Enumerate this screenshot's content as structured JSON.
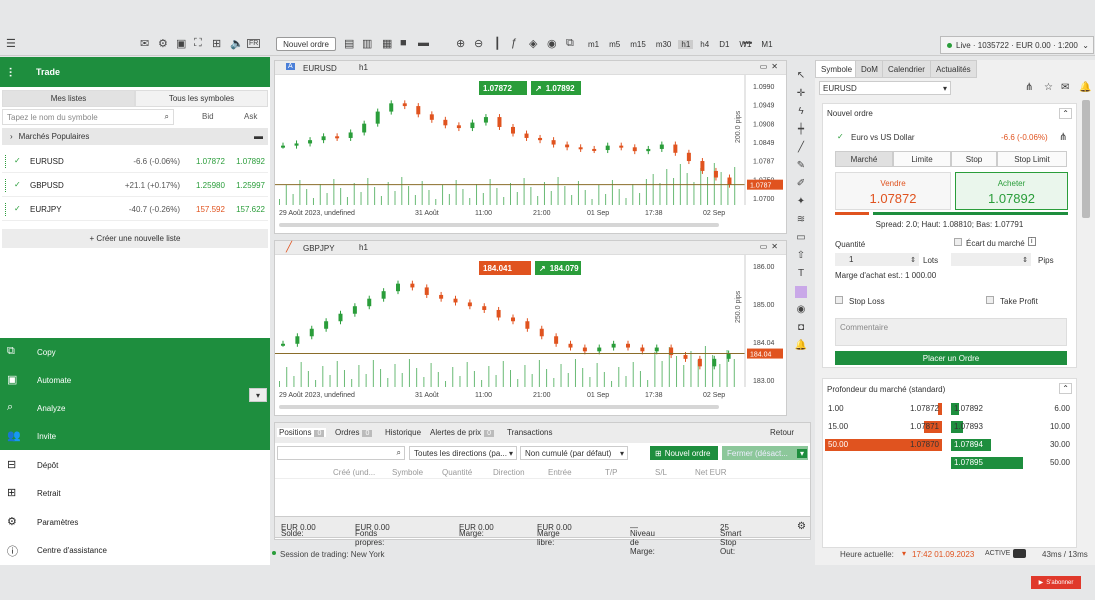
{
  "toolbar": {
    "new_order": "Nouvel ordre",
    "timeframes": [
      "m1",
      "m5",
      "m15",
      "m30",
      "h1",
      "h4",
      "D1",
      "W1",
      "M1"
    ],
    "more": "•••",
    "live": "Live · 1035722 · EUR 0.00 · 1:200"
  },
  "left": {
    "title": "Trade",
    "tabs": [
      "Mes listes",
      "Tous les symboles"
    ],
    "search_placeholder": "Tapez le nom du symbole",
    "bid_header": "Bid",
    "ask_header": "Ask",
    "group": "Marchés Populaires",
    "symbols": [
      {
        "name": "EURUSD",
        "change": "-6.6 (-0.06%)",
        "bid": "1.07872",
        "ask": "1.07892"
      },
      {
        "name": "GBPUSD",
        "change": "+21.1 (+0.17%)",
        "bid": "1.25980",
        "ask": "1.25997"
      },
      {
        "name": "EURJPY",
        "change": "-40.7 (-0.26%)",
        "bid": "157.592",
        "ask": "157.622"
      }
    ],
    "create_list": "+ Créer une nouvelle liste",
    "nav": [
      "Copy",
      "Automate",
      "Analyze",
      "Invite",
      "Dépôt",
      "Retrait",
      "Paramètres",
      "Centre d'assistance"
    ],
    "collapse": "▾"
  },
  "charts": [
    {
      "symbol": "EURUSD",
      "timeframe": "h1",
      "sell": "1.07872",
      "buy": "1.07892",
      "price_labels": [
        "1.0990",
        "1.0949",
        "1.0908",
        "1.0849",
        "1.0787",
        "1.0750",
        "1.0700"
      ],
      "current": "1.0787",
      "pips": "200.0 pips",
      "time_labels": [
        "29 Août 2023, undefined",
        "31 Août",
        "11:00",
        "21:00",
        "01 Sep",
        "17:38",
        "02 Sep"
      ],
      "series": [
        1.0858,
        1.0862,
        1.0868,
        1.0875,
        1.0872,
        1.0882,
        1.0898,
        1.092,
        1.0935,
        1.093,
        1.0915,
        1.0905,
        1.0895,
        1.089,
        1.09,
        1.091,
        1.0892,
        1.088,
        1.0872,
        1.0868,
        1.086,
        1.0855,
        1.0852,
        1.085,
        1.0858,
        1.0855,
        1.0848,
        1.0852,
        1.086,
        1.0845,
        1.083,
        1.0812,
        1.08,
        1.0787
      ]
    },
    {
      "symbol": "GBPJPY",
      "timeframe": "h1",
      "sell": "184.041",
      "buy": "184.079",
      "price_labels": [
        "186.00",
        "185.00",
        "184.04",
        "183.00"
      ],
      "current": "184.04",
      "pips": "250.0 pips",
      "time_labels": [
        "29 Août 2023, undefined",
        "31 Août",
        "11:00",
        "21:00",
        "01 Sep",
        "17:38",
        "02 Sep"
      ],
      "series": [
        184.3,
        184.5,
        184.7,
        184.9,
        185.1,
        185.3,
        185.5,
        185.7,
        185.9,
        185.8,
        185.6,
        185.5,
        185.4,
        185.3,
        185.2,
        185.0,
        184.9,
        184.7,
        184.5,
        184.3,
        184.2,
        184.1,
        184.2,
        184.3,
        184.2,
        184.1,
        184.2,
        184.0,
        183.9,
        183.7,
        183.9,
        184.04
      ]
    }
  ],
  "positions": {
    "tabs": [
      {
        "label": "Positions",
        "count": "0"
      },
      {
        "label": "Ordres",
        "count": "0"
      },
      {
        "label": "Historique",
        "count": ""
      },
      {
        "label": "Alertes de prix",
        "count": "0"
      },
      {
        "label": "Transactions",
        "count": ""
      }
    ],
    "retour": "Retour",
    "filter_direction": "Toutes les directions (pa...",
    "filter_cumul": "Non cumulé (par défaut)",
    "new_order": "Nouvel ordre",
    "close": "Fermer (désact...",
    "columns": [
      "Créé (und...",
      "Symbole",
      "Quantité",
      "Direction",
      "Entrée",
      "T/P",
      "S/L",
      "Net EUR"
    ],
    "account": [
      {
        "label": "Solde:",
        "value": "EUR 0.00"
      },
      {
        "label": "Fonds propres:",
        "value": "EUR 0.00"
      },
      {
        "label": "Marge:",
        "value": "EUR 0.00"
      },
      {
        "label": "Marge libre:",
        "value": "EUR 0.00"
      },
      {
        "label": "Niveau de Marge:",
        "value": "—"
      },
      {
        "label": "Smart Stop Out:",
        "value": "25"
      }
    ]
  },
  "right": {
    "tabs": [
      "Symbole",
      "DoM",
      "Calendrier",
      "Actualités"
    ],
    "symbol": "EURUSD",
    "order_title": "Nouvel ordre",
    "instrument": "Euro vs US Dollar",
    "instrument_change": "-6.6 (-0.06%)",
    "order_types": [
      "Marché",
      "Limite",
      "Stop",
      "Stop Limit"
    ],
    "sell_label": "Vendre",
    "sell_price": "1.07872",
    "buy_label": "Acheter",
    "buy_price": "1.07892",
    "spread": "Spread: 2.0; Haut: 1.08810; Bas: 1.07791",
    "quantity_label": "Quantité",
    "deviation_label": "Écart du marché",
    "quantity_value": "1",
    "lots": "Lots",
    "pips": "Pips",
    "margin": "Marge d'achat est.: 1 000.00",
    "stop_loss": "Stop Loss",
    "take_profit": "Take Profit",
    "comment_placeholder": "Commentaire",
    "place_order": "Placer un Ordre",
    "depth_title": "Profondeur du marché (standard)",
    "depth_bids": [
      {
        "vol": "1.00",
        "price": "1.07872"
      },
      {
        "vol": "15.00",
        "price": "1.07871"
      },
      {
        "vol": "50.00",
        "price": "1.07870"
      }
    ],
    "depth_asks": [
      {
        "price": "1.07892",
        "vol": "6.00"
      },
      {
        "price": "1.07893",
        "vol": "10.00"
      },
      {
        "price": "1.07894",
        "vol": "30.00"
      },
      {
        "price": "1.07895",
        "vol": "50.00"
      }
    ]
  },
  "status": {
    "session": "Session de trading: New York",
    "time_label": "Heure actuelle:",
    "time": "17:42 01.09.2023",
    "active": "ACTIVE",
    "latency": "43ms / 13ms"
  },
  "youtube": "S'abonner",
  "colors": {
    "green": "#1e8e3e",
    "red": "#e0531f"
  }
}
